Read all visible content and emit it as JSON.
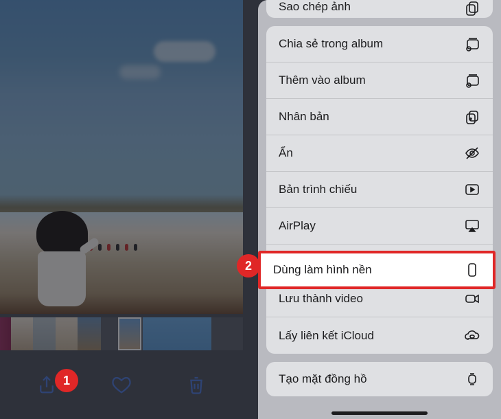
{
  "annotations": {
    "step1": "1",
    "step2": "2"
  },
  "menu": {
    "copyPhoto": "Sao chép ảnh",
    "shareInAlbum": "Chia sẻ trong album",
    "addToAlbum": "Thêm vào album",
    "duplicate": "Nhân bản",
    "hide": "Ẩn",
    "slideshow": "Bản trình chiếu",
    "airplay": "AirPlay",
    "useAsWallpaper": "Dùng làm hình nền",
    "saveAsVideo": "Lưu thành video",
    "icloudLink": "Lấy liên kết iCloud",
    "createWatchFace": "Tạo mặt đồng hồ"
  },
  "icons": {
    "share": "share-icon",
    "favorite": "heart-icon",
    "trash": "trash-icon"
  },
  "colors": {
    "accent": "#e02727",
    "ios_blue": "#4a76d8"
  }
}
